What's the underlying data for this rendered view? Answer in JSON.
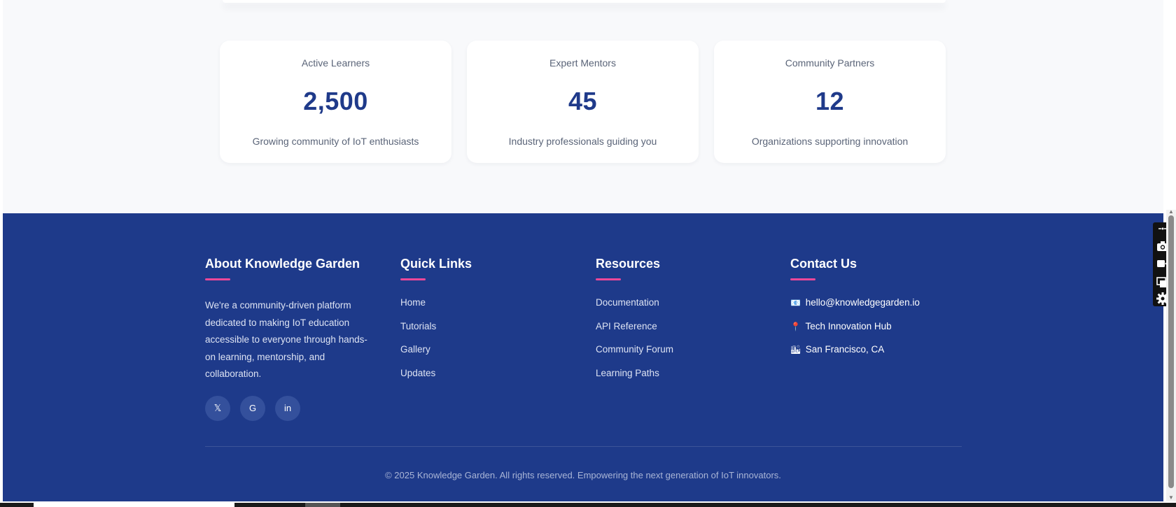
{
  "stats": [
    {
      "label": "Active Learners",
      "value": "2,500",
      "description": "Growing community of IoT enthusiasts"
    },
    {
      "label": "Expert Mentors",
      "value": "45",
      "description": "Industry professionals guiding you"
    },
    {
      "label": "Community Partners",
      "value": "12",
      "description": "Organizations supporting innovation"
    }
  ],
  "footer": {
    "about": {
      "title": "About Knowledge Garden",
      "text": "We're a community-driven platform dedicated to making IoT education accessible to everyone through hands-on learning, mentorship, and collaboration.",
      "socials": [
        {
          "label": "𝕏",
          "icon": "x-icon"
        },
        {
          "label": "G",
          "icon": "github-icon"
        },
        {
          "label": "in",
          "icon": "linkedin-icon"
        }
      ]
    },
    "quick_links": {
      "title": "Quick Links",
      "items": [
        "Home",
        "Tutorials",
        "Gallery",
        "Updates"
      ]
    },
    "resources": {
      "title": "Resources",
      "items": [
        "Documentation",
        "API Reference",
        "Community Forum",
        "Learning Paths"
      ]
    },
    "contact": {
      "title": "Contact Us",
      "items": [
        {
          "icon": "📧",
          "icon_name": "email-icon",
          "text": "hello@knowledgegarden.io"
        },
        {
          "icon": "📍",
          "icon_name": "location-pin-icon",
          "text": "Tech Innovation Hub"
        },
        {
          "icon": "🏙",
          "icon_name": "city-icon",
          "text": "San Francisco, CA"
        }
      ]
    },
    "copyright": "© 2025 Knowledge Garden. All rights reserved. Empowering the next generation of IoT innovators."
  },
  "colors": {
    "footer_bg": "#1e3a8a",
    "accent_underline": "#ec4899",
    "stat_number": "#1f3a8a",
    "page_bg": "#f8f9fb"
  },
  "tools": {
    "icons": [
      "link-icon",
      "camera-icon",
      "video-icon",
      "window-icon",
      "gear-icon"
    ]
  }
}
